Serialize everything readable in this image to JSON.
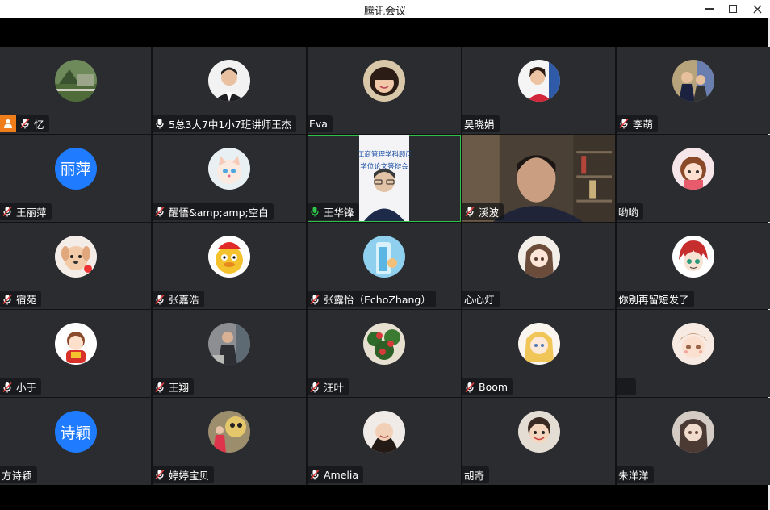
{
  "window": {
    "title": "腾讯会议",
    "controls": {
      "minimize": "minimize",
      "maximize": "maximize",
      "close": "close"
    }
  },
  "participants": [
    {
      "name": "忆",
      "mic": "muted",
      "host": true,
      "avatar_icon": "photo-landscape-avatar"
    },
    {
      "name": "5总3大7中1小7班讲师王杰",
      "mic": "on",
      "avatar_icon": "photo-man-avatar"
    },
    {
      "name": "Eva",
      "mic": "none",
      "avatar_icon": "photo-girl-avatar"
    },
    {
      "name": "吴晓娟",
      "mic": "none",
      "avatar_icon": "photo-woman-avatar"
    },
    {
      "name": "李萌",
      "mic": "muted",
      "avatar_icon": "photo-couple-avatar"
    },
    {
      "name": "王丽萍",
      "mic": "muted",
      "avatar_text": "丽萍"
    },
    {
      "name": "醒悟&amp;amp;空白",
      "mic": "muted",
      "avatar_icon": "cartoon-cat-avatar"
    },
    {
      "name": "王华锋",
      "mic": "speaking",
      "video": "screen-share",
      "active": true,
      "share_text": [
        "工商管理学科顾问",
        "学位论文答辩会"
      ]
    },
    {
      "name": "溪波",
      "mic": "muted",
      "video": "camera"
    },
    {
      "name": "哟哟",
      "mic": "none",
      "avatar_icon": "cartoon-girl-avatar"
    },
    {
      "name": "宿苑",
      "mic": "muted",
      "avatar_icon": "cartoon-dog-avatar"
    },
    {
      "name": "张嘉浩",
      "mic": "muted",
      "avatar_icon": "cartoon-duck-avatar"
    },
    {
      "name": "张露怡（EchoZhang）",
      "mic": "muted",
      "avatar_icon": "blue-drink-avatar"
    },
    {
      "name": "心心灯",
      "mic": "none",
      "avatar_icon": "anime-girl-avatar"
    },
    {
      "name": "你别再留短发了",
      "mic": "none",
      "avatar_icon": "anime-red-hair-avatar"
    },
    {
      "name": "小于",
      "mic": "muted",
      "avatar_icon": "cartoon-child-avatar"
    },
    {
      "name": "王翔",
      "mic": "muted",
      "avatar_icon": "photo-person-avatar"
    },
    {
      "name": "汪叶",
      "mic": "muted",
      "avatar_icon": "flower-avatar"
    },
    {
      "name": "Boom",
      "mic": "muted",
      "avatar_icon": "anime-blonde-avatar"
    },
    {
      "name": "",
      "mic": "none",
      "avatar_icon": "anime-face-avatar"
    },
    {
      "name": "方诗颖",
      "mic": "none",
      "avatar_text": "诗颖"
    },
    {
      "name": "婷婷宝贝",
      "mic": "muted",
      "avatar_icon": "photo-lion-dance-avatar"
    },
    {
      "name": "Amelia",
      "mic": "muted",
      "avatar_icon": "photo-woman-smile-avatar"
    },
    {
      "name": "胡奇",
      "mic": "none",
      "avatar_icon": "photo-child-avatar"
    },
    {
      "name": "朱洋洋",
      "mic": "none",
      "avatar_icon": "anime-dark-hair-avatar"
    }
  ],
  "colors": {
    "tile_bg": "#2a2c30",
    "text_avatar_bg": "#1f7bff",
    "host_badge": "#f07d1c",
    "mic_on": "#ffffff",
    "mic_speaking": "#2fc14a",
    "mic_muted_slash": "#e03b3b",
    "active_border": "#2fc14a"
  }
}
